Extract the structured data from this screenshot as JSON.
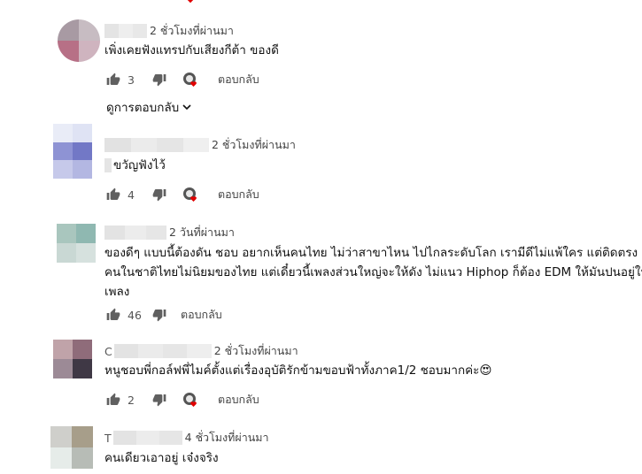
{
  "comments": [
    {
      "time": "2 ชั่วโมงที่ผ่านมา",
      "text": "เพิ่งเคยฟังแทรปกับเสียงกีต้า ของดี",
      "likes": "3",
      "reply": "ตอบกลับ",
      "view_replies": "ดูการตอบกลับ"
    },
    {
      "time": "2 ชั่วโมงที่ผ่านมา",
      "text": "ขวัญฟังไว้",
      "likes": "4",
      "reply": "ตอบกลับ"
    },
    {
      "time": "2 วันที่ผ่านมา",
      "text_lines": [
        "ของดีๆ แบบนี้ต้องดัน ชอบ อยากเห็นคนไทย ไม่ว่าสาขาไหน ไปไกลระดับโลก เรามีดีไม่แพ้ใคร แต่ติดตรง",
        "คนในชาติไทยไม่นิยมของไทย แต่เดี๋ยวนี้เพลงส่วนใหญ่จะให้ดัง ไม่แนว Hiphop ก็ต้อง EDM ให้มันปนอยู่ใน",
        "เพลง"
      ],
      "likes": "46",
      "reply": "ตอบกลับ"
    },
    {
      "name_initial": "C",
      "time": "2 ชั่วโมงที่ผ่านมา",
      "text": "หนูชอบพี่กอล์ฟพี่ไมค์ตั้งแต่เรื่องอุบัติรักข้ามขอบฟ้าทั้งภาค1/2 ชอบมากค่ะ😍",
      "likes": "2",
      "reply": "ตอบกลับ"
    },
    {
      "name_initial": "T",
      "time": "4 ชั่วโมงที่ผ่านมา",
      "text": "คนเดียวเอาอยู่ เจ๋งจริง"
    }
  ],
  "colors": {
    "heart": "#e00000",
    "icon": "#606060"
  }
}
